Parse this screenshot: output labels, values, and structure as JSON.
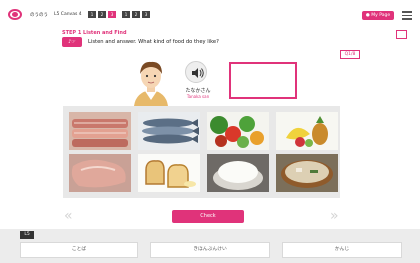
{
  "header": {
    "app_name": "のうのう",
    "course": "L5 Canvas 4",
    "breadcrumbs": [
      "1",
      "2",
      "3",
      "1",
      "2",
      "3"
    ],
    "mypage_label": "My Page"
  },
  "step": {
    "title": "STEP 1 Listen and Find",
    "instruction": "Listen and answer. What kind of food do they like?",
    "question_badge": "Q1/8"
  },
  "speaker": {
    "name": "たなかさん",
    "romaji": "Tanaka san"
  },
  "foods": [
    {
      "name": "bacon"
    },
    {
      "name": "fish"
    },
    {
      "name": "vegetables"
    },
    {
      "name": "fruit"
    },
    {
      "name": "meat"
    },
    {
      "name": "toast"
    },
    {
      "name": "rice"
    },
    {
      "name": "soup"
    }
  ],
  "nav": {
    "prev_label": "«",
    "next_label": "»",
    "check_label": "Check"
  },
  "bottom": {
    "level_label": "L5",
    "tabs": [
      "ことば",
      "きほんぶんけい",
      "かんじ"
    ]
  },
  "colors": {
    "accent": "#e0337a",
    "panel": "#e8e8e8"
  }
}
